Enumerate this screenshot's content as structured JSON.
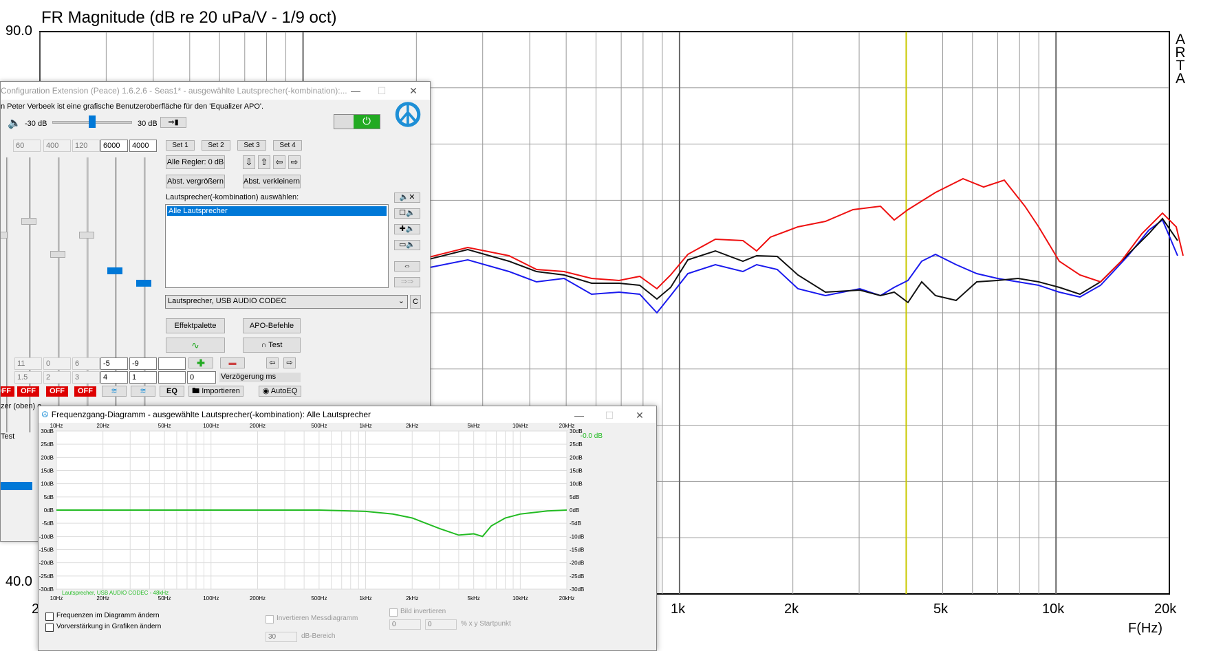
{
  "arta": {
    "title": "FR Magnitude (dB re 20 uPa/V - 1/9 oct)",
    "y_top": "90.0",
    "y_bottom": "40.0",
    "x_ticks": [
      "2",
      "1k",
      "2k",
      "5k",
      "10k",
      "20k"
    ],
    "x_axis_label": "F(Hz)",
    "side_letters": [
      "A",
      "R",
      "T",
      "A"
    ],
    "colors": {
      "red": "#ee1111",
      "black": "#111111",
      "blue": "#1a1aee",
      "marker": "#c8c800",
      "grid": "#999999"
    }
  },
  "peace": {
    "title": "Configuration Extension (Peace) 1.6.2.6 - Seas1* - ausgewählte Lautsprecher(-kombination):...",
    "subtitle": "n Peter Verbeek ist eine grafische Benutzeroberfläche für den 'Equalizer APO'.",
    "vol_min": "-30 dB",
    "vol_max": "30 dB",
    "freqs": [
      "60",
      "400",
      "120",
      "6000",
      "4000"
    ],
    "sets": [
      "Set 1",
      "Set 2",
      "Set 3",
      "Set 4"
    ],
    "all_regler": "Alle Regler: 0 dB",
    "abst_up": "Abst. vergrößern",
    "abst_down": "Abst. verkleinern",
    "speaker_label": "Lautsprecher(-kombination) auswählen:",
    "speaker_item": "Alle Lautsprecher",
    "device": "Lautsprecher, USB AUDIO  CODEC",
    "c_btn": "C",
    "effekt": "Effektpalette",
    "apo": "APO-Befehle",
    "test": "Test",
    "gains": [
      "11",
      "0",
      "6",
      "-5",
      "-9"
    ],
    "qs": [
      "1.5",
      "2",
      "3",
      "4",
      "1"
    ],
    "delay_value": "0",
    "delay_label": "Verzögerung ms",
    "off_label": "OFF",
    "eq": "EQ",
    "import": "Importieren",
    "autoeq": "AutoEQ",
    "side_text1": "zer (oben) o",
    "side_text2": "Test"
  },
  "freq": {
    "title": "Frequenzgang-Diagramm - ausgewählte Lautsprecher(-kombination): Alle Lautsprecher",
    "x_labels": [
      "10Hz",
      "20Hz",
      "50Hz",
      "100Hz",
      "200Hz",
      "500Hz",
      "1kHz",
      "2kHz",
      "5kHz",
      "10kHz",
      "20kHz"
    ],
    "y_labels": [
      "30dB",
      "25dB",
      "20dB",
      "15dB",
      "10dB",
      "5dB",
      "0dB",
      "-5dB",
      "-10dB",
      "-15dB",
      "-20dB",
      "-25dB",
      "-30dB"
    ],
    "readout": "-0.0 dB",
    "legend": "Lautsprecher, USB AUDIO  CODEC - 48kHz",
    "opt1": "Frequenzen im Diagramm ändern",
    "opt2": "Vorverstärkung in Grafiken ändern",
    "opt3": "Invertieren Messdiagramm",
    "opt4": "Bild invertieren",
    "v1": "0",
    "v2": "0",
    "xy": "% x y Startpunkt",
    "v3": "30",
    "db_range": "dB-Bereich",
    "curve_color": "#22bb22"
  }
}
